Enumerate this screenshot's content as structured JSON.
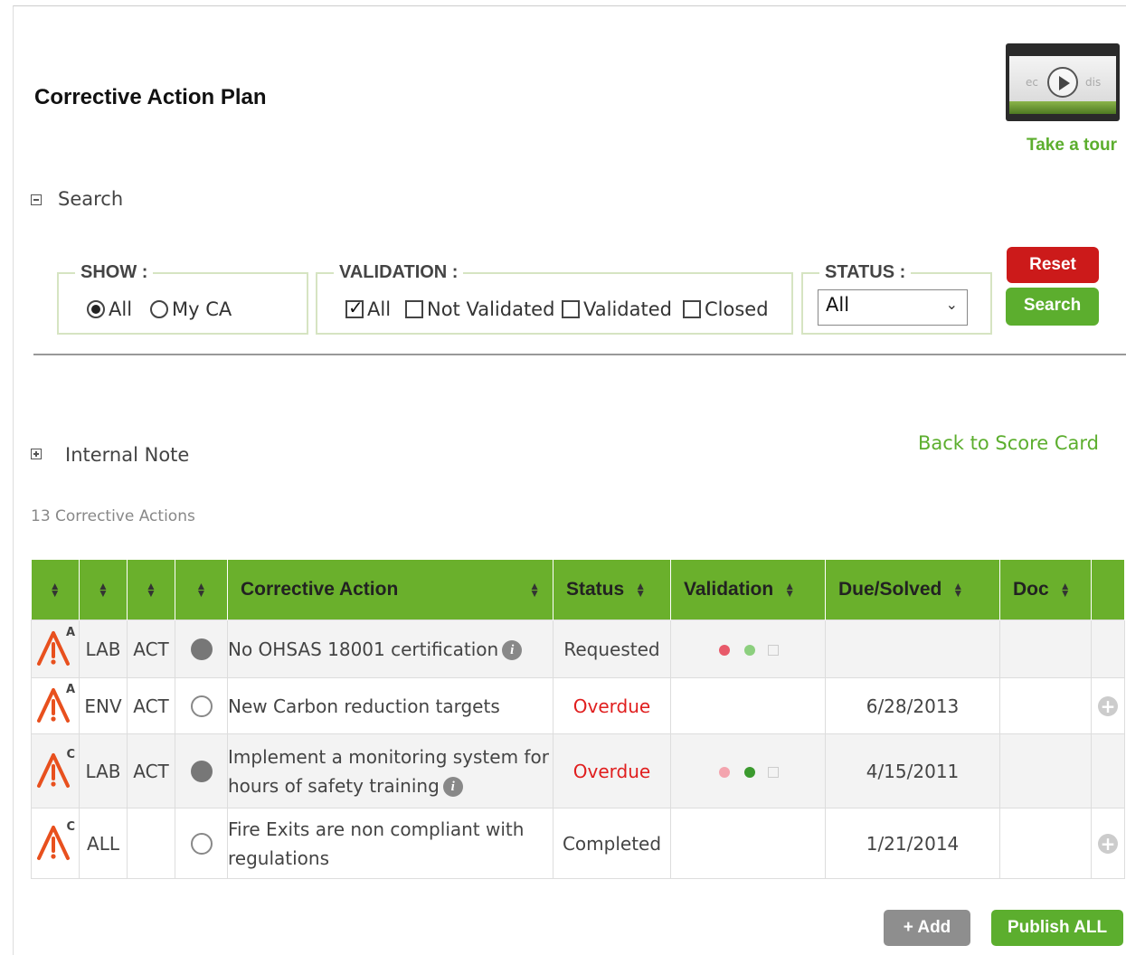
{
  "page": {
    "title": "Corrective Action Plan"
  },
  "tour": {
    "thumb_text_left": "ec",
    "thumb_text_right": "dis",
    "label": "Take a tour"
  },
  "search": {
    "section_label": "Search",
    "show": {
      "legend": "SHOW :",
      "options": [
        "All",
        "My CA"
      ],
      "selected": "All"
    },
    "validation": {
      "legend": "VALIDATION :",
      "options": [
        "All",
        "Not Validated",
        "Validated",
        "Closed"
      ],
      "checked": [
        "All"
      ]
    },
    "status": {
      "legend": "STATUS :",
      "value": "All"
    },
    "reset_label": "Reset",
    "search_label": "Search"
  },
  "internal_note": {
    "label": "Internal Note"
  },
  "back_link": "Back to Score Card",
  "count_text": "13 Corrective Actions",
  "table": {
    "headers": [
      "Corrective Action",
      "Status",
      "Validation",
      "Due/Solved",
      "Doc"
    ],
    "rows": [
      {
        "letter": "A",
        "category": "LAB",
        "type": "ACT",
        "dot": "filled",
        "action": "No OHSAS 18001 certification",
        "has_info": true,
        "status": "Requested",
        "status_color": "#444444",
        "validation_dots": [
          "#e85a6a",
          "#8ccf7e",
          "square"
        ],
        "due": "",
        "add_icon": false
      },
      {
        "letter": "A",
        "category": "ENV",
        "type": "ACT",
        "dot": "empty",
        "action": "New Carbon reduction targets",
        "has_info": false,
        "status": "Overdue",
        "status_color": "#e01e1e",
        "validation_dots": [],
        "due": "6/28/2013",
        "add_icon": true
      },
      {
        "letter": "C",
        "category": "LAB",
        "type": "ACT",
        "dot": "filled",
        "action": "Implement a monitoring system for hours of safety training",
        "has_info": true,
        "status": "Overdue",
        "status_color": "#e01e1e",
        "validation_dots": [
          "#f3a4ae",
          "#3b9a2e",
          "square"
        ],
        "due": "4/15/2011",
        "add_icon": false
      },
      {
        "letter": "C",
        "category": "ALL",
        "type": "",
        "dot": "empty",
        "action": "Fire Exits are non compliant with regulations",
        "has_info": false,
        "status": "Completed",
        "status_color": "#444444",
        "validation_dots": [],
        "due": "1/21/2014",
        "add_icon": true
      }
    ]
  },
  "actions": {
    "add_label": "+ Add",
    "publish_label": "Publish ALL"
  }
}
